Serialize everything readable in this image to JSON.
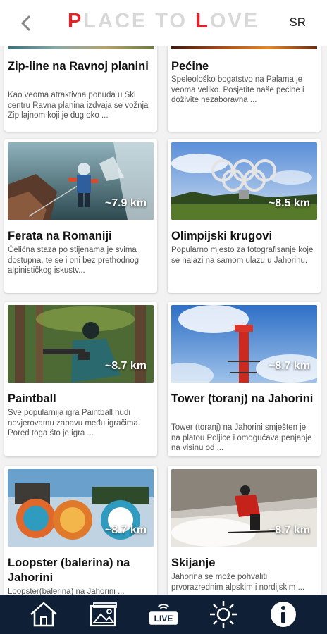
{
  "header": {
    "logo_part1": "P",
    "logo_part2": "LACE TO ",
    "logo_part3": "L",
    "logo_part4": "OVE",
    "lang": "SR"
  },
  "cards": [
    {
      "title": "Zip-line na Ravnoj planini",
      "desc": "Kao veoma atraktivna ponuda u Ski centru Ravna planina izdvaja se vožnja Zip lajnom koji je dug oko ..."
    },
    {
      "title": "Pećine",
      "desc": "Speleološko bogatstvo na Palama je veoma veliko. Posjetite naše pećine i doživite nezaboravna ..."
    },
    {
      "title": "Ferata na Romaniji",
      "distance": "~7.9 km",
      "desc": "Čelična staza po stijenama je svima dostupna, te se i oni bez prethodnog alpinističkog iskustv..."
    },
    {
      "title": " Olimpijski krugovi",
      "distance": "~8.5 km",
      "desc": "Popularno mjesto za fotografisanje koje se nalazi na samom ulazu u Jahorinu."
    },
    {
      "title": "Paintball",
      "distance": "~8.7 km",
      "desc": "Sve popularnija igra Paintball nudi nevjerovatnu zabavu među igračima. Pored toga što je igra ..."
    },
    {
      "title": "Tower (toranj) na Jahorini",
      "distance": "~8.7 km",
      "desc": "Tower (toranj) na Jahorini smješten je na platou Poljice i omogućava penjanje na visinu od ..."
    },
    {
      "title": "Loopster (balerina) na Jahorini",
      "distance": "~8.7 km",
      "desc": "Loopster(balerina) na Jahorini ..."
    },
    {
      "title": "Skijanje",
      "distance": "~8.7 km",
      "desc": "Jahorina se može pohvaliti prvorazrednim alpskim i nordijskim ..."
    }
  ],
  "nav": {
    "items": [
      "home-icon",
      "gallery-icon",
      "live-icon",
      "weather-icon",
      "info-icon"
    ],
    "live_label": "LIVE"
  },
  "colors": {
    "accent": "#e02229",
    "nav_bg": "#0f2036"
  }
}
